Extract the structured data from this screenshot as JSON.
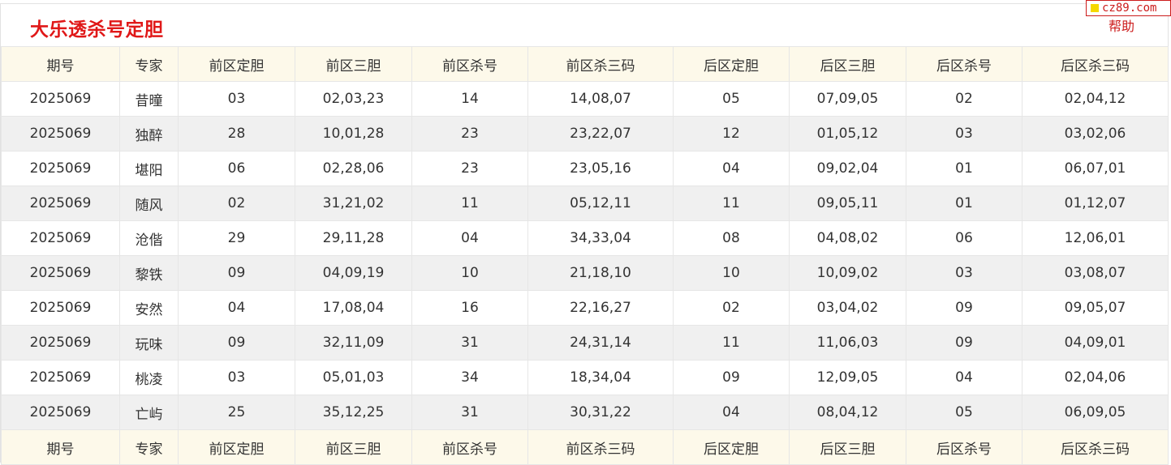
{
  "title": "大乐透杀号定胆",
  "watermark": "cz89.com",
  "help_label": "帮助",
  "columns": [
    "期号",
    "专家",
    "前区定胆",
    "前区三胆",
    "前区杀号",
    "前区杀三码",
    "后区定胆",
    "后区三胆",
    "后区杀号",
    "后区杀三码"
  ],
  "rows": [
    [
      "2025069",
      "昔曈",
      "03",
      "02,03,23",
      "14",
      "14,08,07",
      "05",
      "07,09,05",
      "02",
      "02,04,12"
    ],
    [
      "2025069",
      "独醉",
      "28",
      "10,01,28",
      "23",
      "23,22,07",
      "12",
      "01,05,12",
      "03",
      "03,02,06"
    ],
    [
      "2025069",
      "堪阳",
      "06",
      "02,28,06",
      "23",
      "23,05,16",
      "04",
      "09,02,04",
      "01",
      "06,07,01"
    ],
    [
      "2025069",
      "随风",
      "02",
      "31,21,02",
      "11",
      "05,12,11",
      "11",
      "09,05,11",
      "01",
      "01,12,07"
    ],
    [
      "2025069",
      "沧偕",
      "29",
      "29,11,28",
      "04",
      "34,33,04",
      "08",
      "04,08,02",
      "06",
      "12,06,01"
    ],
    [
      "2025069",
      "黎铁",
      "09",
      "04,09,19",
      "10",
      "21,18,10",
      "10",
      "10,09,02",
      "03",
      "03,08,07"
    ],
    [
      "2025069",
      "安然",
      "04",
      "17,08,04",
      "16",
      "22,16,27",
      "02",
      "03,04,02",
      "09",
      "09,05,07"
    ],
    [
      "2025069",
      "玩味",
      "09",
      "32,11,09",
      "31",
      "24,31,14",
      "11",
      "11,06,03",
      "09",
      "04,09,01"
    ],
    [
      "2025069",
      "桃凌",
      "03",
      "05,01,03",
      "34",
      "18,34,04",
      "09",
      "12,09,05",
      "04",
      "02,04,06"
    ],
    [
      "2025069",
      "亡屿",
      "25",
      "35,12,25",
      "31",
      "30,31,22",
      "04",
      "08,04,12",
      "05",
      "06,09,05"
    ]
  ],
  "colors": {
    "title": "#e01818",
    "header_bg": "#fdf9ea",
    "stripe_bg": "#f0f0f0",
    "watermark_border": "#cc1c1c",
    "watermark_square": "#f5d800"
  }
}
